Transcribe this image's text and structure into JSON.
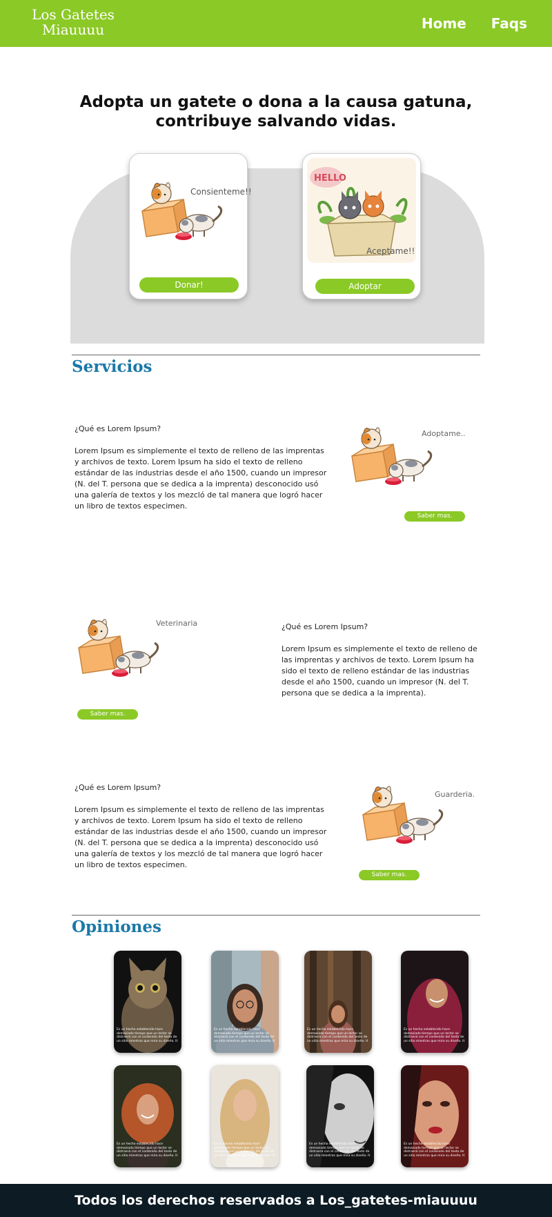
{
  "header": {
    "logo_line1": "Los Gatetes",
    "logo_line2": "Miauuuu",
    "nav_home": "Home",
    "nav_faqs": "Faqs",
    "bg_color": "#8bc926"
  },
  "hero": {
    "title_line1": "Adopta un gatete o dona a la causa gatuna,",
    "title_line2": "contribuye salvando vidas.",
    "card1": {
      "caption": "Consienteme!!",
      "button": "Donar!"
    },
    "card2": {
      "sign": "HELLO",
      "caption": "Aceptame!!",
      "button": "Adoptar"
    }
  },
  "services": {
    "title": "Servicios",
    "items": [
      {
        "question": "¿Qué es Lorem Ipsum?",
        "text": "Lorem Ipsum es simplemente el texto de relleno de las imprentas y archivos de texto. Lorem Ipsum ha sido el texto de relleno estándar de las industrias desde el año 1500, cuando un impresor (N. del T. persona que se dedica a la imprenta) desconocido usó una galería de textos y los mezcló de tal manera que logró hacer un libro de textos especimen.",
        "caption": "Adoptame..",
        "button": "Saber mas."
      },
      {
        "question": "¿Qué es Lorem Ipsum?",
        "text": "Lorem Ipsum es simplemente el texto de relleno de las imprentas y archivos de texto. Lorem Ipsum ha sido el texto de relleno estándar de las industrias desde el año 1500, cuando un impresor (N. del T. persona que se dedica a la imprenta).",
        "caption": "Veterinaria",
        "button": "Saber mas."
      },
      {
        "question": "¿Qué es Lorem Ipsum?",
        "text": "Lorem Ipsum es simplemente el texto de relleno de las imprentas y archivos de texto. Lorem Ipsum ha sido el texto de relleno estándar de las industrias desde el año 1500, cuando un impresor (N. del T. persona que se dedica a la imprenta) desconocido usó una galería de textos y los mezcló de tal manera que logró hacer un libro de textos especimen.",
        "caption": "Guarderia.",
        "button": "Saber mas."
      }
    ]
  },
  "opinions": {
    "title": "Opiniones",
    "card_text": "Es un hecho establecido hace demasiado tiempo que un lector se distraerá con el contenido del texto de un sitio mientras que mira su diseño. It"
  },
  "footer": {
    "text": "Todos los derechos reservados a Los_gatetes-miauuuu"
  },
  "colors": {
    "accent_green": "#8bc926",
    "title_blue": "#1b78a8",
    "footer_dark": "#0c1b24"
  }
}
